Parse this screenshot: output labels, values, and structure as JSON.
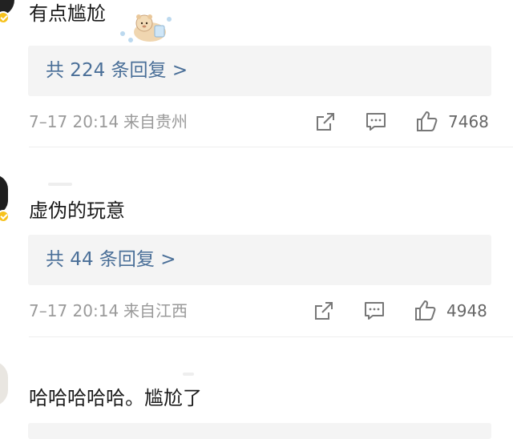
{
  "colors": {
    "reply_link": "#4a6f98",
    "reply_bg": "#f4f4f4",
    "meta": "#9a9a9a",
    "badge": "#f7c21c"
  },
  "comments": [
    {
      "text": "有点尴尬",
      "sticker_icon": "bear-sticker-icon",
      "reply_link": "共 224 条回复 >",
      "time": "7–17 20:14",
      "location": "来自贵州",
      "likes": "7468",
      "actions": [
        "share-icon",
        "comment-icon",
        "like-icon"
      ]
    },
    {
      "text": "虚伪的玩意",
      "reply_link": "共 44 条回复 >",
      "time": "7–17 20:14",
      "location": "来自江西",
      "likes": "4948",
      "actions": [
        "share-icon",
        "comment-icon",
        "like-icon"
      ]
    },
    {
      "text": "哈哈哈哈哈。尴尬了"
    }
  ]
}
